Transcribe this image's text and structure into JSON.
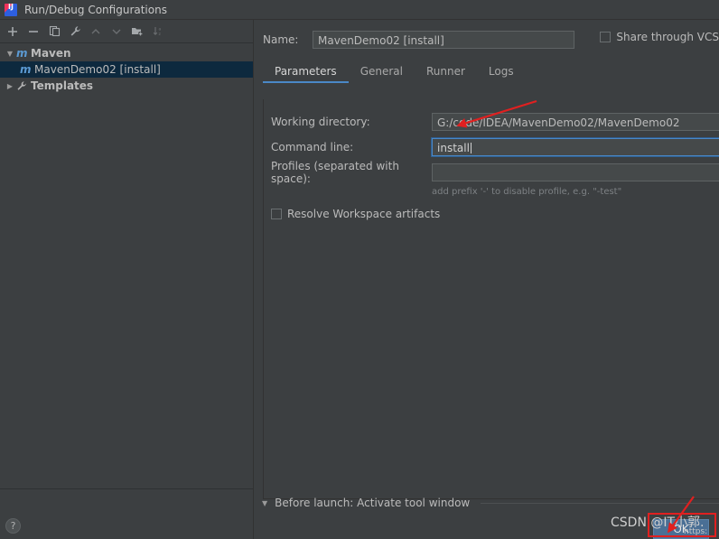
{
  "window": {
    "title": "Run/Debug Configurations",
    "app_icon": "intellij-idea-icon"
  },
  "toolbar": {
    "buttons": [
      {
        "name": "add-configuration-button",
        "icon": "plus-icon",
        "label": "+"
      },
      {
        "name": "remove-configuration-button",
        "icon": "minus-icon",
        "label": "−"
      },
      {
        "name": "copy-configuration-button",
        "icon": "copy-icon",
        "label": "copy"
      },
      {
        "name": "edit-templates-button",
        "icon": "wrench-icon",
        "label": "wrench"
      },
      {
        "name": "move-up-button",
        "icon": "chevron-up-icon",
        "label": "up"
      },
      {
        "name": "move-down-button",
        "icon": "chevron-down-icon",
        "label": "down"
      },
      {
        "name": "create-folder-button",
        "icon": "folder-add-icon",
        "label": "folder"
      },
      {
        "name": "sort-configurations-button",
        "icon": "sort-az-icon",
        "label": "sort"
      }
    ]
  },
  "tree": {
    "nodes": [
      {
        "label": "Maven",
        "icon": "maven-m-icon",
        "twisty": "▼",
        "selected": false,
        "indent": false
      },
      {
        "label": "MavenDemo02 [install]",
        "icon": "maven-m-icon",
        "twisty": "",
        "selected": true,
        "indent": true
      },
      {
        "label": "Templates",
        "icon": "wrench-icon",
        "twisty": "▶",
        "selected": false,
        "indent": false
      }
    ]
  },
  "help": {
    "label": "?"
  },
  "config": {
    "name_label": "Name:",
    "name_value": "MavenDemo02 [install]",
    "share_label": "Share through VCS",
    "share_checked": false
  },
  "tabs": [
    {
      "label": "Parameters",
      "active": true
    },
    {
      "label": "General",
      "active": false
    },
    {
      "label": "Runner",
      "active": false
    },
    {
      "label": "Logs",
      "active": false
    }
  ],
  "parameters": {
    "working_directory_label": "Working directory:",
    "working_directory_value": "G:/code/IDEA/MavenDemo02/MavenDemo02",
    "command_line_label": "Command line:",
    "command_line_value": "install",
    "command_line_placeholder": "",
    "profiles_label": "Profiles (separated with space):",
    "profiles_value": "",
    "profiles_hint": "add prefix '-' to disable profile, e.g. \"-test\"",
    "resolve_workspace_label": "Resolve Workspace artifacts",
    "resolve_workspace_checked": false
  },
  "before_launch": {
    "twisty": "▼",
    "label": "Before launch: Activate tool window"
  },
  "dialog_buttons": {
    "ok_label": "OK"
  },
  "watermark": {
    "text": "CSDN @IT小郭.",
    "subtext": "https:"
  },
  "colors": {
    "window_bg": "#3c3f41",
    "selection_bg": "#0d293e",
    "accent_blue": "#4a88c7",
    "maven_icon": "#5b9ad3",
    "annotation_red": "#e02020",
    "ok_button_bg": "#4a6f95"
  }
}
